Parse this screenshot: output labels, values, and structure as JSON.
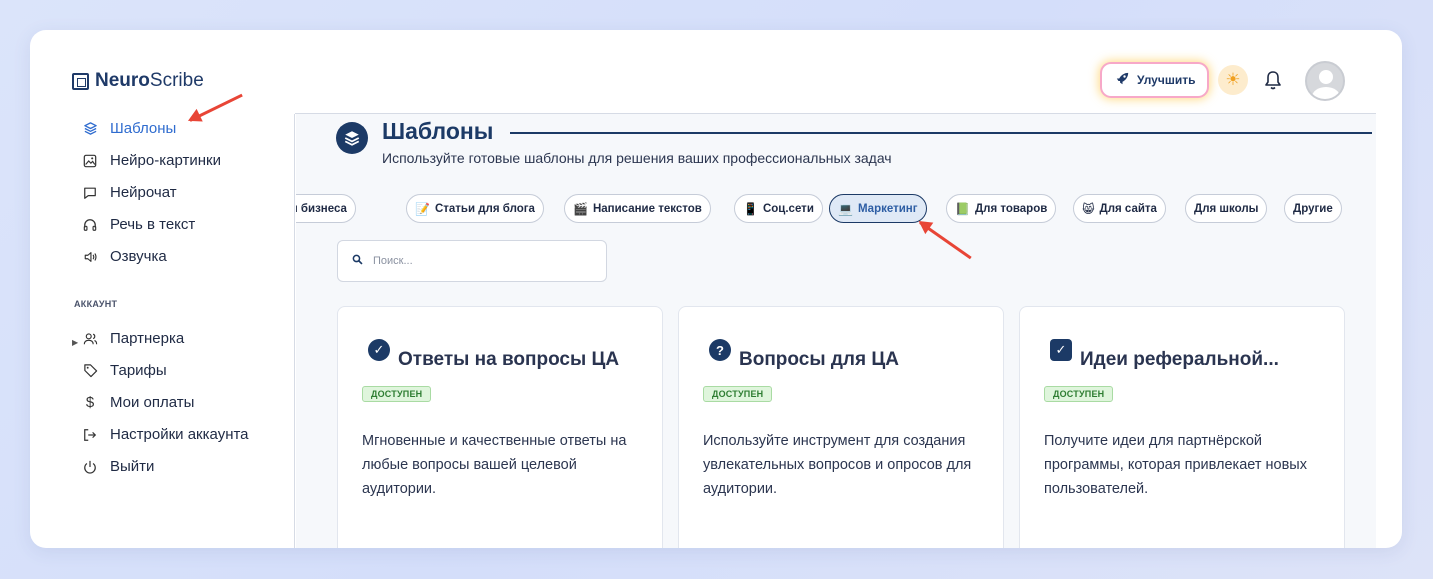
{
  "brand": {
    "bold": "Neuro",
    "light": "Scribe"
  },
  "header": {
    "upgrade_label": "Улучшить"
  },
  "sidebar": {
    "items": [
      {
        "label": "Шаблоны"
      },
      {
        "label": "Нейро-картинки"
      },
      {
        "label": "Нейрочат"
      },
      {
        "label": "Речь в текст"
      },
      {
        "label": "Озвучка"
      }
    ],
    "account_section": "АККАУНТ",
    "account_items": [
      {
        "label": "Партнерка"
      },
      {
        "label": "Тарифы"
      },
      {
        "label": "Мои оплаты"
      },
      {
        "label": "Настройки аккаунта"
      },
      {
        "label": "Выйти"
      }
    ]
  },
  "main": {
    "title": "Шаблоны",
    "subtitle": "Используйте готовые шаблоны для решения ваших профессиональных задач",
    "chips": [
      {
        "label": "я бизнеса",
        "emoji": ""
      },
      {
        "label": "Статьи для блога",
        "emoji": "📝"
      },
      {
        "label": "Написание текстов",
        "emoji": "🎬"
      },
      {
        "label": "Соц.сети",
        "emoji": "📱"
      },
      {
        "label": "Маркетинг",
        "emoji": "💻"
      },
      {
        "label": "Для товаров",
        "emoji": "📗"
      },
      {
        "label": "Для сайта",
        "emoji": "😸"
      },
      {
        "label": "Для школы",
        "emoji": ""
      },
      {
        "label": "Другие",
        "emoji": ""
      }
    ],
    "active_chip": "Маркетинг",
    "search_placeholder": "Поиск...",
    "cards": [
      {
        "title": "Ответы на вопросы ЦА",
        "badge": "ДОСТУПЕН",
        "description": "Мгновенные и качественные ответы на любые вопросы вашей целевой аудитории."
      },
      {
        "title": "Вопросы для ЦА",
        "badge": "ДОСТУПЕН",
        "description": "Используйте инструмент для создания увлекательных вопросов и опросов для аудитории."
      },
      {
        "title": "Идеи реферальной...",
        "badge": "ДОСТУПЕН",
        "description": "Получите идеи для партнёрской программы, которая привлекает новых пользователей."
      }
    ]
  },
  "colors": {
    "accent": "#1c3a66",
    "active_nav": "#2f6ccf",
    "badge_bg": "#dff5dc",
    "arrow": "#e84536"
  }
}
